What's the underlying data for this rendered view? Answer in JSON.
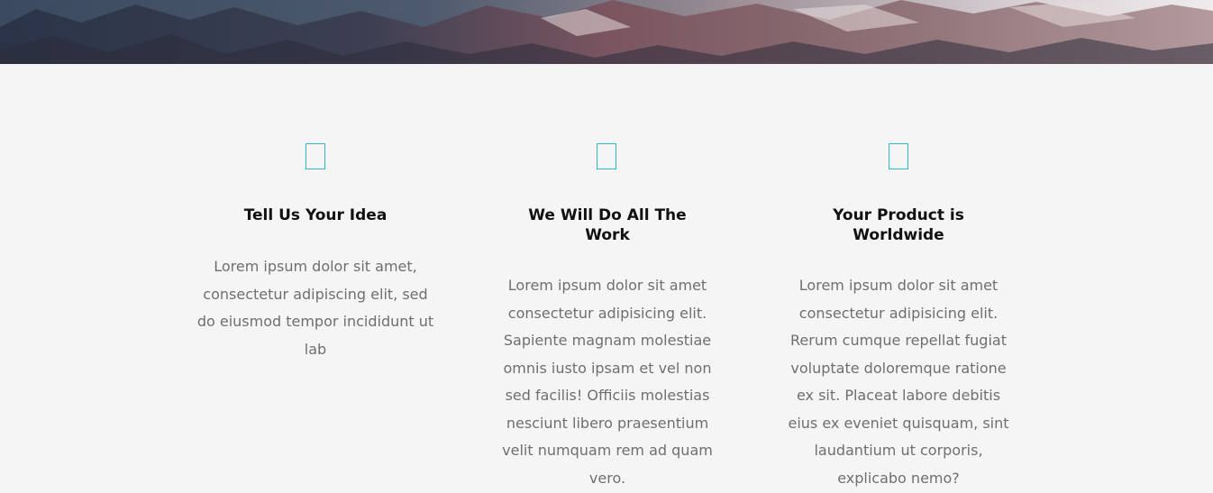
{
  "hero": {
    "image_alt_icon": "mountain-landscape-image"
  },
  "features": [
    {
      "icon": "outline-square-icon",
      "title": "Tell Us Your Idea",
      "text": "Lorem ipsum dolor sit amet, consectetur adipiscing elit, sed do eiusmod tempor incididunt ut lab"
    },
    {
      "icon": "outline-square-icon",
      "title": "We Will Do All The Work",
      "text": "Lorem ipsum dolor sit amet consectetur adipisicing elit. Sapiente magnam molestiae omnis iusto ipsam et vel non sed facilis! Officiis molestias nesciunt libero praesentium velit numquam rem ad quam vero."
    },
    {
      "icon": "outline-square-icon",
      "title": "Your Product is Worldwide",
      "text": "Lorem ipsum dolor sit amet consectetur adipisicing elit. Rerum cumque repellat fugiat voluptate doloremque ratione ex sit. Placeat labore debitis eius ex eveniet quisquam, sint laudantium ut corporis, explicabo nemo?"
    }
  ],
  "colors": {
    "accent": "#2bbcc0",
    "background": "#f5f5f5",
    "heading": "#111111",
    "body_text": "#6f6f6f"
  }
}
